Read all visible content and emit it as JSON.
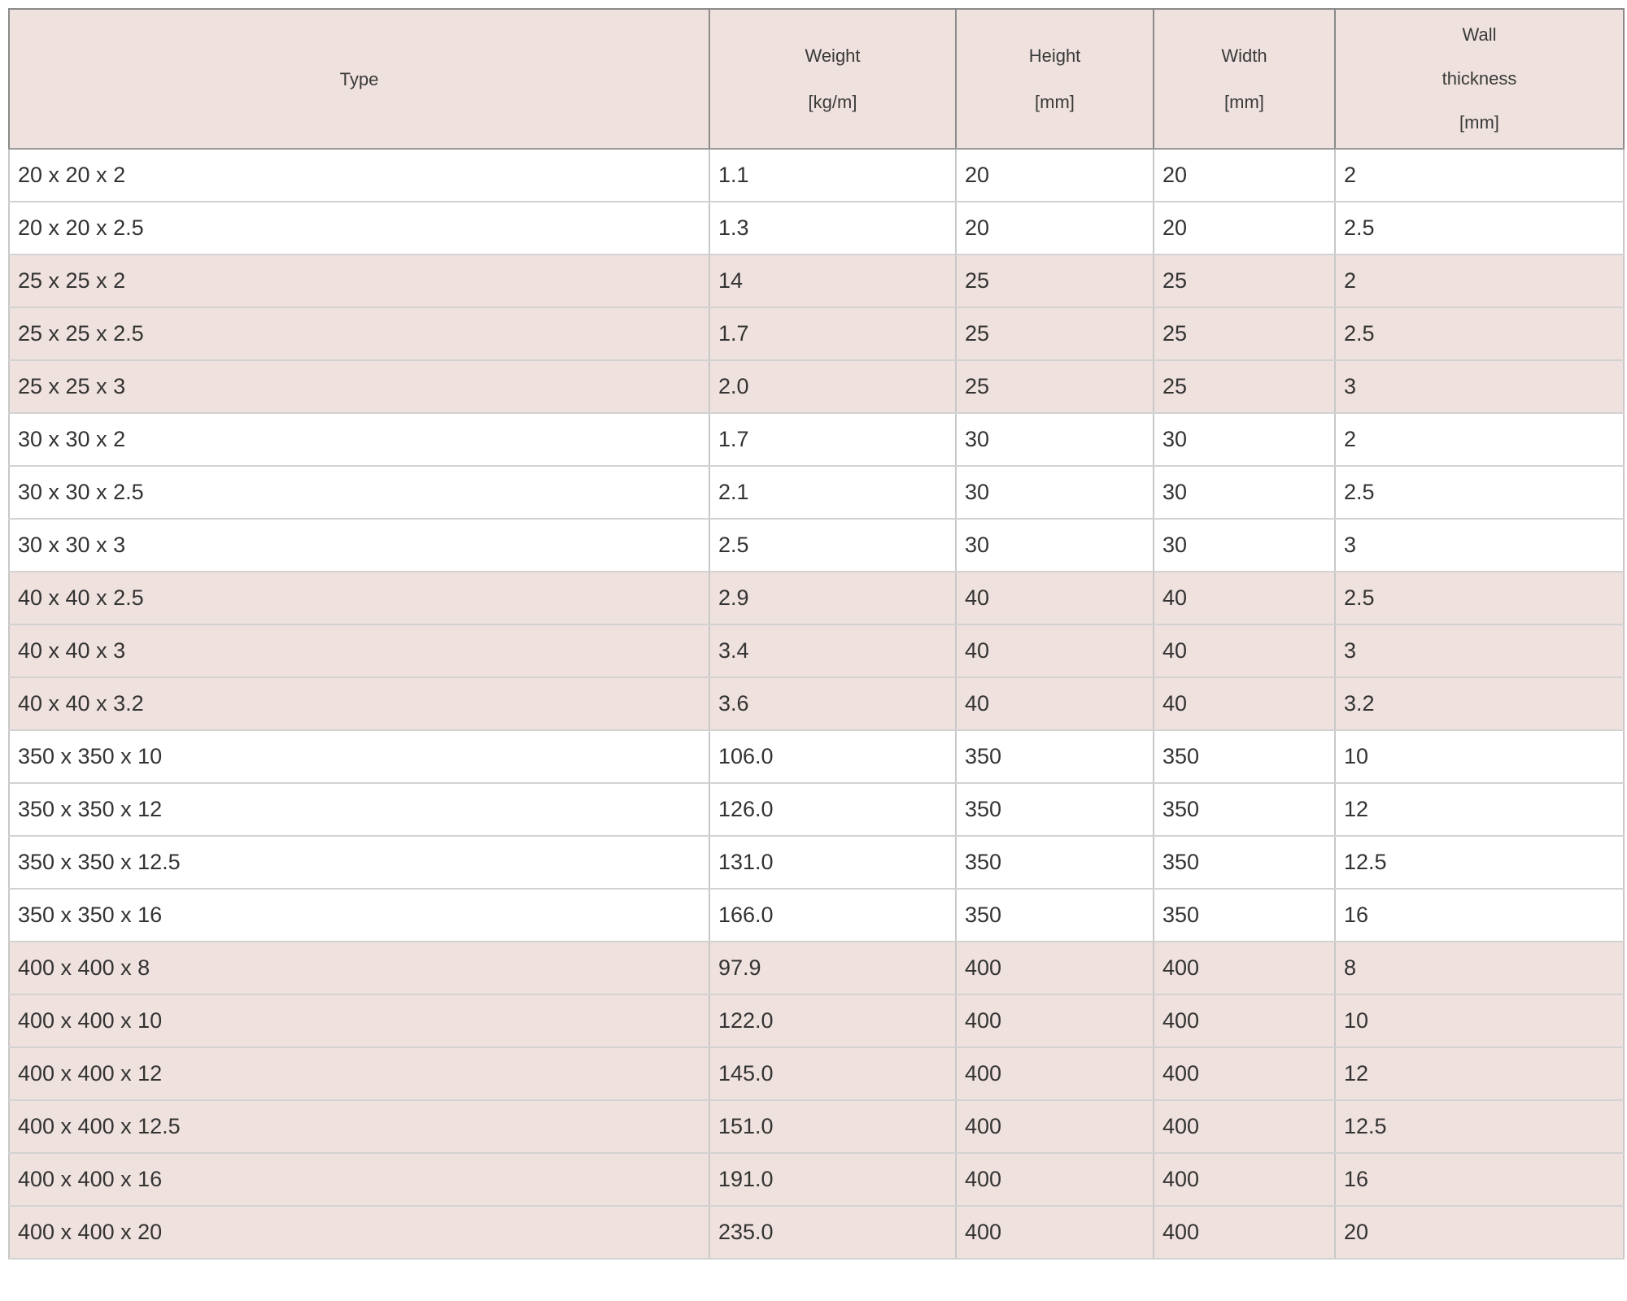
{
  "table": {
    "headers": [
      {
        "lines": [
          "Type"
        ]
      },
      {
        "lines": [
          "Weight",
          "[kg/m]"
        ]
      },
      {
        "lines": [
          "Height",
          "[mm]"
        ]
      },
      {
        "lines": [
          "Width",
          "[mm]"
        ]
      },
      {
        "lines": [
          "Wall",
          "thickness",
          "[mm]"
        ]
      }
    ],
    "rows": [
      {
        "shaded": false,
        "cells": [
          "20 x 20 x 2",
          "1.1",
          "20",
          "20",
          "2"
        ]
      },
      {
        "shaded": false,
        "cells": [
          "20 x 20 x 2.5",
          "1.3",
          "20",
          "20",
          "2.5"
        ]
      },
      {
        "shaded": true,
        "cells": [
          "25 x 25 x 2",
          "14",
          "25",
          "25",
          "2"
        ]
      },
      {
        "shaded": true,
        "cells": [
          "25 x 25 x 2.5",
          "1.7",
          "25",
          "25",
          "2.5"
        ]
      },
      {
        "shaded": true,
        "cells": [
          "25 x 25 x 3",
          "2.0",
          "25",
          "25",
          "3"
        ]
      },
      {
        "shaded": false,
        "cells": [
          "30 x 30 x 2",
          "1.7",
          "30",
          "30",
          "2"
        ]
      },
      {
        "shaded": false,
        "cells": [
          "30 x 30 x 2.5",
          "2.1",
          "30",
          "30",
          "2.5"
        ]
      },
      {
        "shaded": false,
        "cells": [
          "30 x 30 x 3",
          "2.5",
          "30",
          "30",
          "3"
        ]
      },
      {
        "shaded": true,
        "cells": [
          "40 x 40 x 2.5",
          "2.9",
          "40",
          "40",
          "2.5"
        ]
      },
      {
        "shaded": true,
        "cells": [
          "40 x 40 x 3",
          "3.4",
          "40",
          "40",
          "3"
        ]
      },
      {
        "shaded": true,
        "cells": [
          "40 x 40 x 3.2",
          "3.6",
          "40",
          "40",
          "3.2"
        ]
      },
      {
        "shaded": false,
        "cells": [
          "350 x 350 x 10",
          "106.0",
          "350",
          "350",
          "10"
        ]
      },
      {
        "shaded": false,
        "cells": [
          "350 x 350 x 12",
          "126.0",
          "350",
          "350",
          "12"
        ]
      },
      {
        "shaded": false,
        "cells": [
          "350 x 350 x 12.5",
          "131.0",
          "350",
          "350",
          "12.5"
        ]
      },
      {
        "shaded": false,
        "cells": [
          "350 x 350 x 16",
          "166.0",
          "350",
          "350",
          "16"
        ]
      },
      {
        "shaded": true,
        "cells": [
          "400 x 400 x 8",
          "97.9",
          "400",
          "400",
          "8"
        ]
      },
      {
        "shaded": true,
        "cells": [
          "400 x 400 x 10",
          "122.0",
          "400",
          "400",
          "10"
        ]
      },
      {
        "shaded": true,
        "cells": [
          "400 x 400 x 12",
          "145.0",
          "400",
          "400",
          "12"
        ]
      },
      {
        "shaded": true,
        "cells": [
          "400 x 400 x 12.5",
          "151.0",
          "400",
          "400",
          "12.5"
        ]
      },
      {
        "shaded": true,
        "cells": [
          "400 x 400 x 16",
          "191.0",
          "400",
          "400",
          "16"
        ]
      },
      {
        "shaded": true,
        "cells": [
          "400 x 400 x 20",
          "235.0",
          "400",
          "400",
          "20"
        ]
      }
    ]
  },
  "colors": {
    "shaded_row": "#efe1dd",
    "plain_row": "#ffffff",
    "text": "#333333"
  }
}
